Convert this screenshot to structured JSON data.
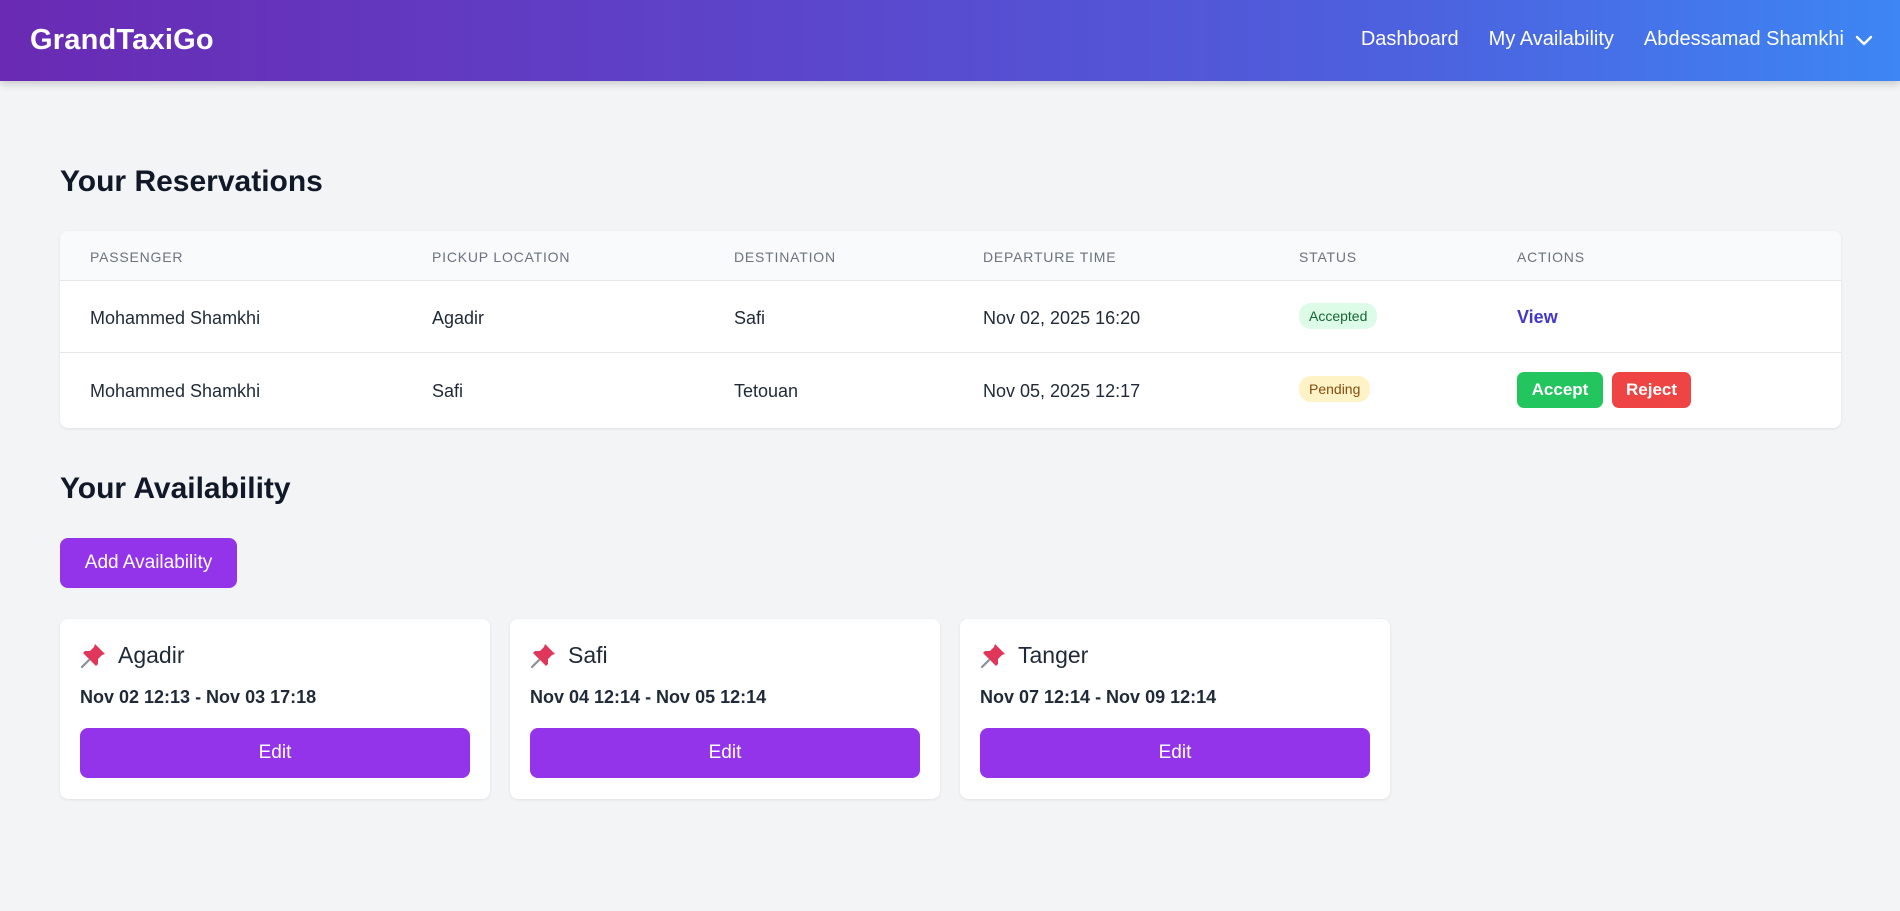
{
  "nav": {
    "brand": "GrandTaxiGo",
    "links": [
      "Dashboard",
      "My Availability"
    ],
    "user_name": "Abdessamad Shamkhi"
  },
  "reservations": {
    "heading": "Your Reservations",
    "columns": [
      "Passenger",
      "Pickup Location",
      "Destination",
      "Departure Time",
      "Status",
      "Actions"
    ],
    "rows": [
      {
        "passenger": "Mohammed Shamkhi",
        "pickup": "Agadir",
        "destination": "Safi",
        "departure": "Nov 02, 2025 16:20",
        "status": "Accepted",
        "action_view": "View"
      },
      {
        "passenger": "Mohammed Shamkhi",
        "pickup": "Safi",
        "destination": "Tetouan",
        "departure": "Nov 05, 2025 12:17",
        "status": "Pending",
        "action_accept": "Accept",
        "action_reject": "Reject"
      }
    ]
  },
  "availability": {
    "heading": "Your Availability",
    "add_button": "Add Availability",
    "cards": [
      {
        "city": "Agadir",
        "dates": "Nov 02 12:13 - Nov 03 17:18",
        "edit": "Edit"
      },
      {
        "city": "Safi",
        "dates": "Nov 04 12:14 - Nov 05 12:14",
        "edit": "Edit"
      },
      {
        "city": "Tanger",
        "dates": "Nov 07 12:14 - Nov 09 12:14",
        "edit": "Edit"
      }
    ]
  },
  "icons": {
    "user_menu": "chevron-down-icon",
    "card": "pushpin-icon"
  },
  "colors": {
    "primary": "#9333ea",
    "accept": "#22c55e",
    "reject": "#ef4444",
    "link": "#4338ca",
    "badge_accepted_bg": "#dcfce7",
    "badge_pending_bg": "#fef3c7"
  }
}
